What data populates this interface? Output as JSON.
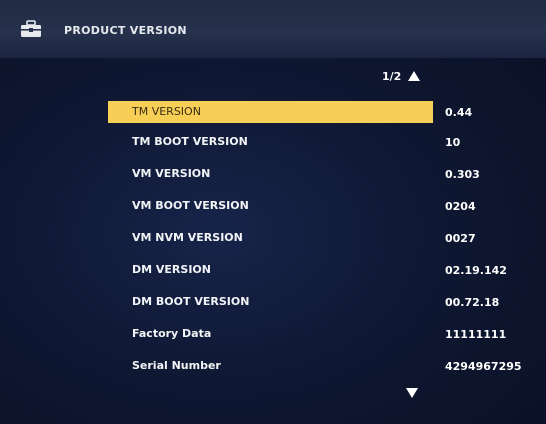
{
  "header": {
    "title": "PRODUCT VERSION",
    "icon": "toolbox-icon"
  },
  "pager": {
    "indicator": "1/2"
  },
  "rows": [
    {
      "label": "TM VERSION",
      "value": "0.44"
    },
    {
      "label": "TM BOOT VERSION",
      "value": "10"
    },
    {
      "label": "VM VERSION",
      "value": "0.303"
    },
    {
      "label": "VM BOOT VERSION",
      "value": "0204"
    },
    {
      "label": "VM NVM VERSION",
      "value": "0027"
    },
    {
      "label": "DM VERSION",
      "value": "02.19.142"
    },
    {
      "label": "DM BOOT VERSION",
      "value": "00.72.18"
    },
    {
      "label": "Factory Data",
      "value": "11111111"
    },
    {
      "label": "Serial Number",
      "value": "4294967295"
    }
  ],
  "colors": {
    "selected_row": "#f7cf56",
    "background": "#0f1833",
    "text": "#ffffff"
  }
}
